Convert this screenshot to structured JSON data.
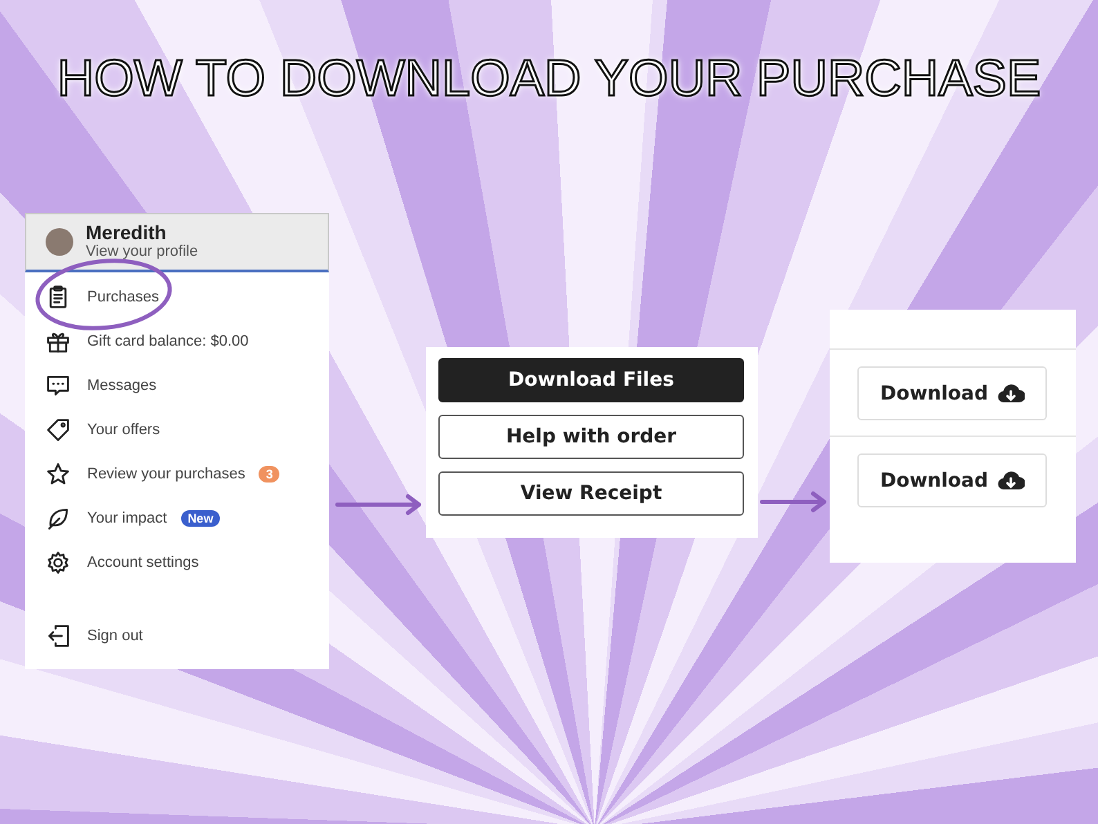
{
  "title": "HOW TO DOWNLOAD YOUR PURCHASE",
  "profile": {
    "name": "Meredith",
    "subtitle": "View your profile"
  },
  "menu_items": [
    {
      "kind": "clipboard",
      "label": "Purchases",
      "circled": true
    },
    {
      "kind": "gift",
      "label": "Gift card balance: $0.00",
      "circled": false
    },
    {
      "kind": "message",
      "label": "Messages",
      "circled": false
    },
    {
      "kind": "tag",
      "label": "Your offers",
      "circled": false
    },
    {
      "kind": "star",
      "label": "Review your purchases",
      "circled": false,
      "badge": {
        "text": "3",
        "color": "#f0925f"
      }
    },
    {
      "kind": "leaf",
      "label": "Your impact",
      "circled": false,
      "badge": {
        "text": "New",
        "color": "#3a5fcd"
      }
    },
    {
      "kind": "gear",
      "label": "Account settings",
      "circled": false
    }
  ],
  "sign_out": {
    "kind": "exit",
    "label": "Sign out"
  },
  "order_buttons": [
    {
      "label": "Download Files",
      "primary": true
    },
    {
      "label": "Help with order",
      "primary": false
    },
    {
      "label": "View Receipt",
      "primary": false
    }
  ],
  "download_buttons": [
    {
      "label": "Download"
    },
    {
      "label": "Download"
    }
  ]
}
